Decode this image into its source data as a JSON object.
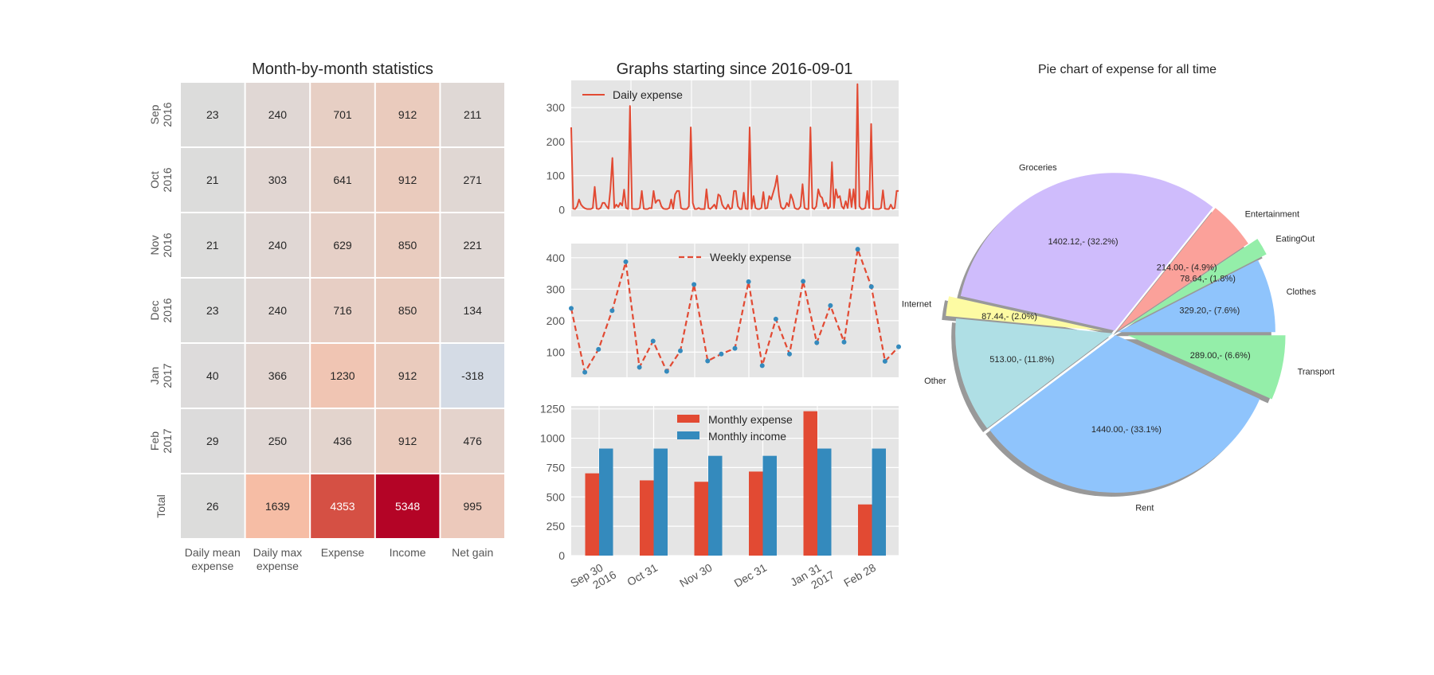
{
  "chart_data": [
    {
      "type": "heatmap",
      "title": "Month-by-month statistics",
      "columns": [
        [
          "Daily mean",
          "expense"
        ],
        [
          "Daily max",
          "expense"
        ],
        [
          "Expense"
        ],
        [
          "Income"
        ],
        [
          "Net gain"
        ]
      ],
      "rows": [
        [
          "Sep",
          "2016"
        ],
        [
          "Oct",
          "2016"
        ],
        [
          "Nov",
          "2016"
        ],
        [
          "Dec",
          "2016"
        ],
        [
          "Jan",
          "2017"
        ],
        [
          "Feb",
          "2017"
        ],
        [
          "Total"
        ]
      ],
      "values": [
        [
          23,
          240,
          701,
          912,
          211
        ],
        [
          21,
          303,
          641,
          912,
          271
        ],
        [
          21,
          240,
          629,
          850,
          221
        ],
        [
          23,
          240,
          716,
          850,
          134
        ],
        [
          40,
          366,
          1230,
          912,
          -318
        ],
        [
          29,
          250,
          436,
          912,
          476
        ],
        [
          26,
          1639,
          4353,
          5348,
          995
        ]
      ],
      "colormap": "diverging gray-to-red (RdBu_r style)"
    },
    {
      "type": "line",
      "title": "Graphs starting since 2016-09-01",
      "series": [
        {
          "name": "Daily expense",
          "color": "#e24a33",
          "values": [
            242,
            3,
            2,
            10,
            30,
            15,
            8,
            4,
            2,
            2,
            2,
            5,
            67,
            3,
            2,
            5,
            20,
            20,
            10,
            3,
            60,
            152,
            5,
            15,
            8,
            20,
            12,
            59,
            5,
            2,
            305,
            3,
            2,
            2,
            2,
            5,
            55,
            3,
            2,
            2,
            5,
            4,
            55,
            20,
            28,
            28,
            10,
            3,
            2,
            2,
            5,
            30,
            3,
            45,
            55,
            55,
            5,
            2,
            2,
            2,
            10,
            242,
            20,
            2,
            2,
            5,
            2,
            2,
            2,
            60,
            5,
            2,
            8,
            15,
            3,
            45,
            40,
            15,
            5,
            2,
            15,
            2,
            5,
            55,
            55,
            10,
            2,
            2,
            50,
            3,
            2,
            242,
            3,
            40,
            5,
            2,
            2,
            5,
            52,
            3,
            5,
            40,
            30,
            50,
            70,
            100,
            40,
            8,
            2,
            5,
            20,
            10,
            45,
            30,
            5,
            2,
            2,
            10,
            75,
            5,
            2,
            2,
            242,
            5,
            2,
            10,
            60,
            40,
            35,
            10,
            20,
            3,
            8,
            140,
            5,
            60,
            35,
            40,
            10,
            3,
            25,
            5,
            60,
            8,
            60,
            3,
            369,
            10,
            2,
            2,
            5,
            55,
            5,
            252,
            3,
            2,
            2,
            2,
            5,
            57,
            3,
            2,
            2,
            15,
            3,
            5,
            55,
            55
          ]
        }
      ],
      "yticks": [
        0,
        100,
        200,
        300
      ],
      "ylim": [
        -20,
        380
      ],
      "grid": true
    },
    {
      "type": "line",
      "series": [
        {
          "name": "Weekly expense",
          "line_color": "#e24a33",
          "marker_color": "#348abd",
          "line_style": "dashed",
          "values": [
            239,
            36,
            109,
            232,
            387,
            52,
            135,
            39,
            104,
            315,
            72,
            94,
            112,
            324,
            57,
            205,
            94,
            325,
            130,
            248,
            132,
            427,
            308,
            71,
            117
          ]
        }
      ],
      "yticks": [
        100,
        200,
        300,
        400
      ],
      "ylim": [
        20,
        445
      ],
      "grid": true
    },
    {
      "type": "bar",
      "categories": [
        [
          "Sep 30",
          "2016"
        ],
        [
          "Oct 31"
        ],
        [
          "Nov 30"
        ],
        [
          "Dec 31"
        ],
        [
          "Jan 31",
          "2017"
        ],
        [
          "Feb 28"
        ]
      ],
      "series": [
        {
          "name": "Monthly expense",
          "color": "#e24a33",
          "values": [
            701,
            641,
            629,
            716,
            1230,
            436
          ]
        },
        {
          "name": "Monthly income",
          "color": "#348abd",
          "values": [
            912,
            912,
            850,
            850,
            912,
            912
          ]
        }
      ],
      "yticks": [
        0,
        250,
        500,
        750,
        1000,
        1250
      ],
      "ylim": [
        0,
        1275
      ],
      "legend": "top-right",
      "grid": true
    },
    {
      "type": "pie",
      "title": "Pie chart of expense for all time",
      "labels": [
        "Clothes",
        "EatingOut",
        "Entertainment",
        "Groceries",
        "Internet",
        "Other",
        "Rent",
        "Transport"
      ],
      "values": [
        329.2,
        78.64,
        214.0,
        1402.12,
        87.44,
        513.0,
        1440.0,
        289.0
      ],
      "autopct": [
        "329.20,- (7.6%)",
        "78.64,- (1.8%)",
        "214.00,- (4.9%)",
        "1402.12,- (32.2%)",
        "87.44,- (2.0%)",
        "513.00,- (11.8%)",
        "1440.00,- (33.1%)",
        "289.00,- (6.6%)"
      ],
      "colors": [
        "#8fc4fc",
        "#94eea9",
        "#fba19a",
        "#cfbcfc",
        "#fdfba3",
        "#afdfe5",
        "#8fc4fc",
        "#94eea9"
      ],
      "exploded": [
        "EatingOut",
        "Internet",
        "Transport"
      ],
      "shadow": true
    }
  ]
}
